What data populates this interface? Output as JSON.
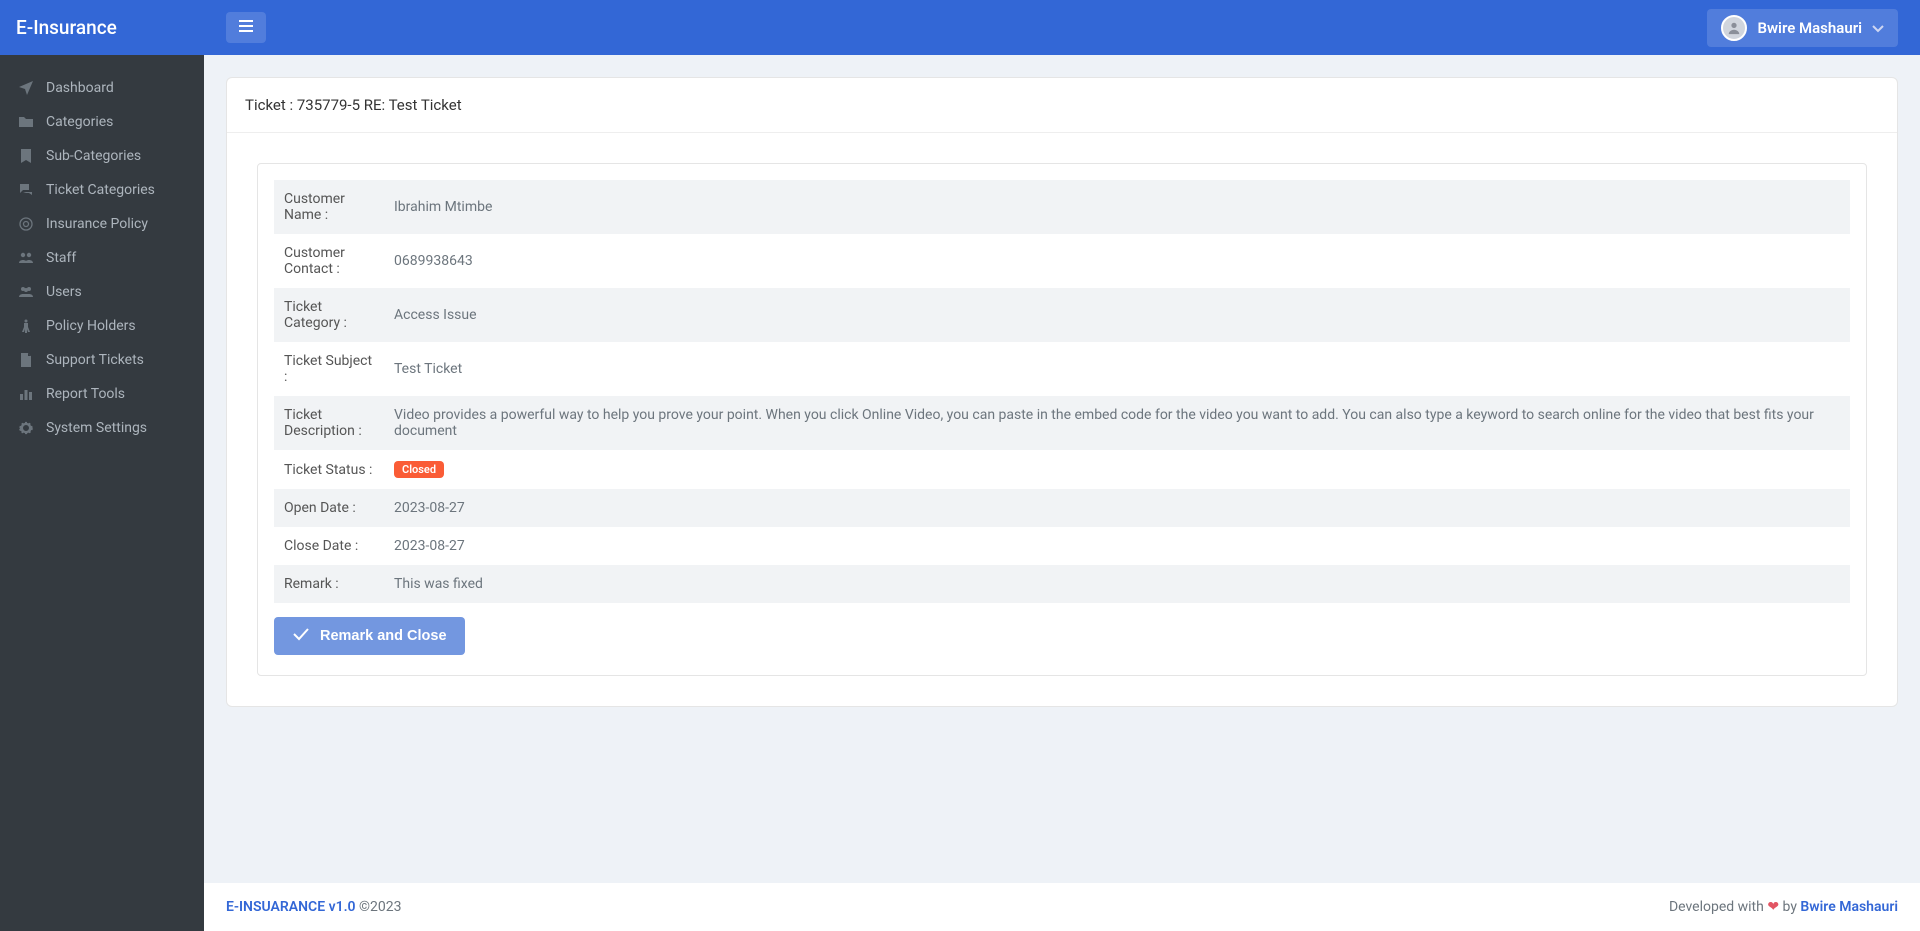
{
  "brand": "E-Insurance",
  "sidebar": {
    "items": [
      {
        "icon": "location-arrow",
        "label": "Dashboard"
      },
      {
        "icon": "folder",
        "label": "Categories"
      },
      {
        "icon": "bookmark",
        "label": "Sub-Categories"
      },
      {
        "icon": "comments",
        "label": "Ticket Categories"
      },
      {
        "icon": "shield",
        "label": "Insurance Policy"
      },
      {
        "icon": "user-group",
        "label": "Staff"
      },
      {
        "icon": "users",
        "label": "Users"
      },
      {
        "icon": "person",
        "label": "Policy Holders"
      },
      {
        "icon": "file",
        "label": "Support Tickets"
      },
      {
        "icon": "chart-bar",
        "label": "Report Tools"
      },
      {
        "icon": "gear",
        "label": "System Settings"
      }
    ]
  },
  "topbar": {
    "user_name": "Bwire Mashauri"
  },
  "page": {
    "title_prefix": "Ticket : ",
    "ticket_no": "735779-5",
    "title_middle": " RE: ",
    "ticket_subject_in_title": "Test Ticket"
  },
  "ticket": {
    "rows": [
      {
        "label": "Customer Name :",
        "value": "Ibrahim Mtimbe"
      },
      {
        "label": "Customer Contact :",
        "value": "0689938643"
      },
      {
        "label": "Ticket Category :",
        "value": "Access Issue"
      },
      {
        "label": "Ticket Subject :",
        "value": "Test Ticket"
      },
      {
        "label": "Ticket Description :",
        "value": "Video provides a powerful way to help you prove your point. When you click Online Video, you can paste in the embed code for the video you want to add. You can also type a keyword to search online for the video that best fits your document"
      },
      {
        "label": "Ticket Status :",
        "value": "Closed",
        "is_badge": true
      },
      {
        "label": "Open Date :",
        "value": "2023-08-27"
      },
      {
        "label": "Close Date :",
        "value": "2023-08-27"
      },
      {
        "label": "Remark :",
        "value": "This was fixed"
      }
    ],
    "action_button": "Remark and Close"
  },
  "footer": {
    "left_brand": "E-INSUARANCE v1.0",
    "left_rest": " ©2023",
    "right_pre": "Developed with ",
    "right_mid": " by ",
    "right_link": "Bwire Mashauri"
  }
}
